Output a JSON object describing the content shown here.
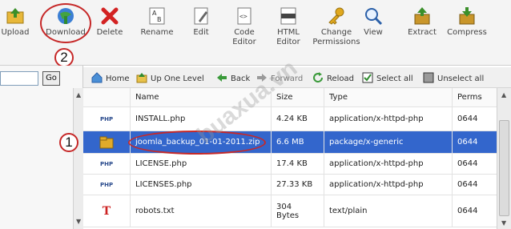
{
  "toolbar": {
    "upload": "Upload",
    "download": "Download",
    "delete": "Delete",
    "rename": "Rename",
    "edit": "Edit",
    "code_editor": "Code\nEditor",
    "html_editor": "HTML\nEditor",
    "change_permissions": "Change\nPermissions",
    "view": "View",
    "extract": "Extract",
    "compress": "Compress"
  },
  "left_panel": {
    "go_label": "Go",
    "path_value": ""
  },
  "nav": {
    "home": "Home",
    "up_one_level": "Up One Level",
    "back": "Back",
    "forward": "Forward",
    "reload": "Reload",
    "select_all": "Select all",
    "unselect_all": "Unselect all"
  },
  "table": {
    "headers": {
      "name": "Name",
      "size": "Size",
      "type": "Type",
      "perms": "Perms"
    },
    "rows": [
      {
        "icon": "php-file-icon",
        "name": "INSTALL.php",
        "size": "4.24 KB",
        "type": "application/x-httpd-php",
        "perms": "0644"
      },
      {
        "icon": "archive-file-icon",
        "name": "joomla_backup_01-01-2011.zip",
        "size": "6.6 MB",
        "type": "package/x-generic",
        "perms": "0644"
      },
      {
        "icon": "php-file-icon",
        "name": "LICENSE.php",
        "size": "17.4 KB",
        "type": "application/x-httpd-php",
        "perms": "0644"
      },
      {
        "icon": "php-file-icon",
        "name": "LICENSES.php",
        "size": "27.33 KB",
        "type": "application/x-httpd-php",
        "perms": "0644"
      },
      {
        "icon": "text-file-icon",
        "name": "robots.txt",
        "size": "304\nBytes",
        "type": "text/plain",
        "perms": "0644"
      }
    ],
    "selected_row": 1
  },
  "callouts": {
    "one": "1",
    "two": "2"
  },
  "watermark": "buaxua.vn",
  "colors": {
    "selection": "#3366cc",
    "callout": "#c62828",
    "php_icon": "#2a4b8d",
    "archive_icon": "#d9a21b",
    "text_icon": "#cc2222"
  }
}
